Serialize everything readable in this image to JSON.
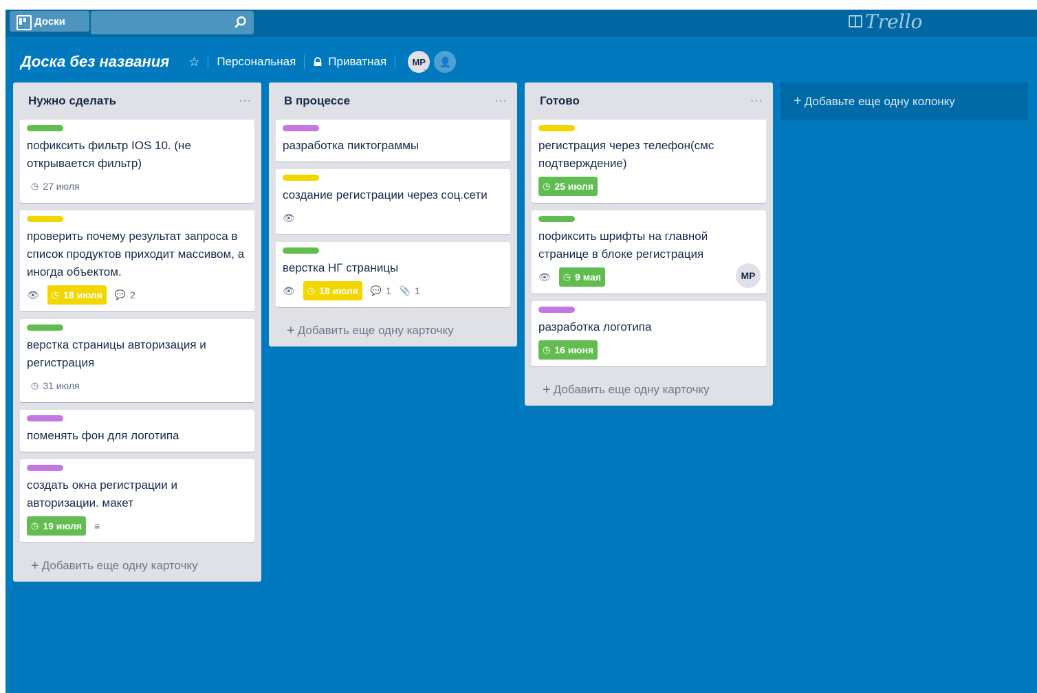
{
  "topbar": {
    "boards_label": "Доски",
    "search_value": "",
    "logo_text": "Trello"
  },
  "board": {
    "title": "Доска без названия",
    "team": "Персональная",
    "visibility": "Приватная",
    "member_initials": "МР"
  },
  "colors": {
    "green": "#61bd4f",
    "yellow": "#f2d600",
    "purple": "#c377e0",
    "board_bg": "#0079bf"
  },
  "lists": [
    {
      "title": "Нужно сделать",
      "add_card": "Добавить еще одну карточку",
      "cards": [
        {
          "label": "green",
          "title": "пофиксить фильтр IOS 10. (не открывается фильтр)",
          "due": "27 июля",
          "due_style": "plain"
        },
        {
          "label": "yellow",
          "title": "проверить почему результат запроса в список продуктов приходит массивом, а иногда объектом.",
          "watch": true,
          "due": "18 июля",
          "due_style": "yellow",
          "comments": "2"
        },
        {
          "label": "green",
          "title": "верстка страницы авторизация и регистрация",
          "due": "31 июля",
          "due_style": "plain"
        },
        {
          "label": "purple",
          "title": "поменять фон для логотипа"
        },
        {
          "label": "purple",
          "title": "создать окна регистрации и авторизации. макет",
          "due": "19 июля",
          "due_style": "green",
          "description": true
        }
      ]
    },
    {
      "title": "В процессе",
      "add_card": "Добавить еще одну карточку",
      "cards": [
        {
          "label": "purple",
          "title": "разработка пиктограммы"
        },
        {
          "label": "yellow",
          "title": "создание регистрации через соц.сети",
          "watch": true
        },
        {
          "label": "green",
          "title": "верстка НГ страницы",
          "watch": true,
          "due": "18 июля",
          "due_style": "yellow",
          "comments": "1",
          "attachments": "1"
        }
      ]
    },
    {
      "title": "Готово",
      "add_card": "Добавить еще одну карточку",
      "cards": [
        {
          "label": "yellow",
          "title": "регистрация через телефон(смс подтверждение)",
          "due": "25 июля",
          "due_style": "green"
        },
        {
          "label": "green",
          "title": "пофиксить шрифты на главной странице в блоке регистрация",
          "watch": true,
          "due": "9 мая",
          "due_style": "green",
          "member": "МР"
        },
        {
          "label": "purple",
          "title": "разработка логотипа",
          "due": "16 июня",
          "due_style": "green"
        }
      ]
    }
  ],
  "add_list": "Добавьте еще одну колонку"
}
